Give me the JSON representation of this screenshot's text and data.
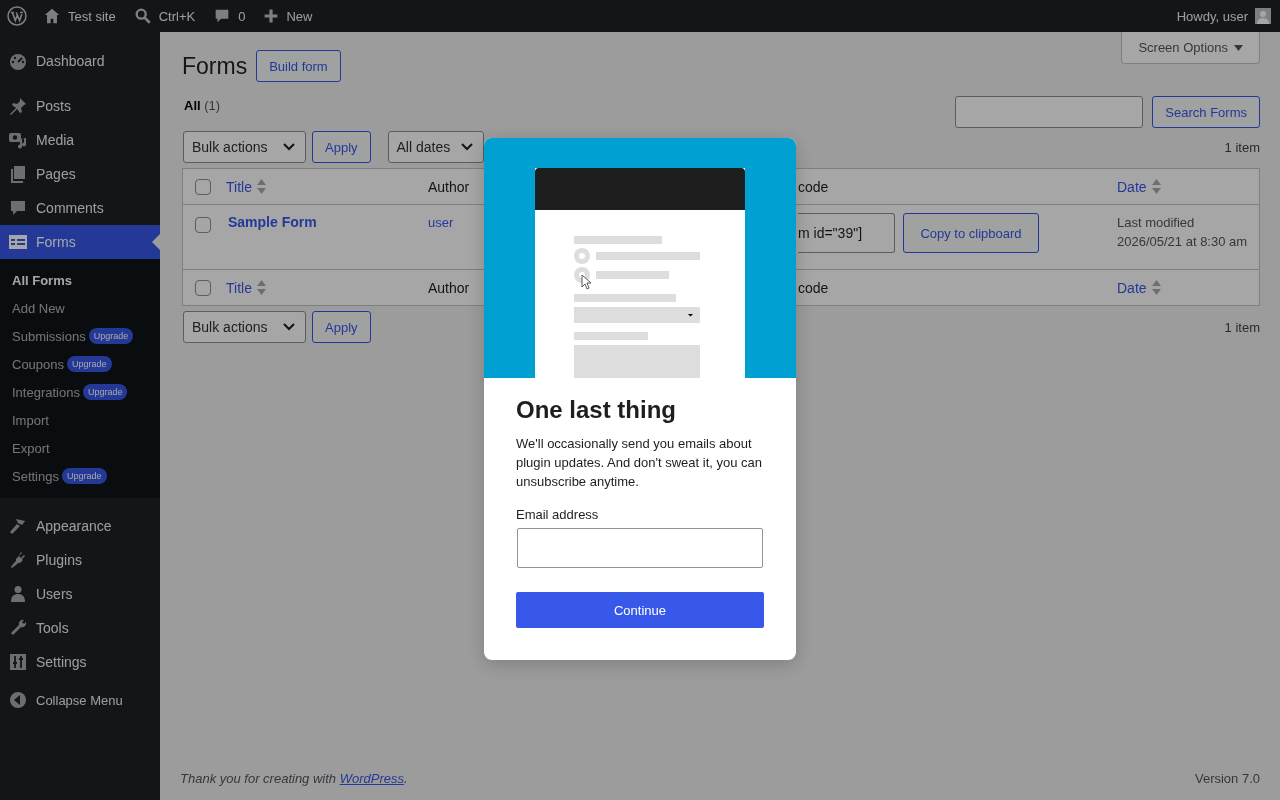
{
  "admin_bar": {
    "site": "Test site",
    "search": "Ctrl+K",
    "comments": "0",
    "new": "New",
    "greeting": "Howdy, user"
  },
  "sidebar": {
    "groups": [
      [
        {
          "label": "Dashboard",
          "selected": false
        }
      ],
      [
        {
          "label": "Posts",
          "selected": false
        },
        {
          "label": "Media",
          "selected": false
        },
        {
          "label": "Pages",
          "selected": false
        },
        {
          "label": "Comments",
          "selected": false
        },
        {
          "label": "Forms",
          "selected": true,
          "submenu": [
            {
              "label": "All Forms",
              "selected": true
            },
            {
              "label": "Add New",
              "selected": false
            },
            {
              "label": "Submissions",
              "badge": "Upgrade",
              "selected": false
            },
            {
              "label": "Coupons",
              "badge": "Upgrade",
              "selected": false
            },
            {
              "label": "Integrations",
              "badge": "Upgrade",
              "selected": false
            },
            {
              "label": "Import",
              "selected": false
            },
            {
              "label": "Export",
              "selected": false
            },
            {
              "label": "Settings",
              "badge": "Upgrade",
              "selected": false
            }
          ]
        }
      ],
      [
        {
          "label": "Appearance",
          "selected": false
        },
        {
          "label": "Plugins",
          "selected": false
        },
        {
          "label": "Users",
          "selected": false
        },
        {
          "label": "Tools",
          "selected": false
        },
        {
          "label": "Settings",
          "selected": false
        }
      ]
    ],
    "collapse": "Collapse Menu"
  },
  "page": {
    "title": "Forms",
    "build_button": "Build form",
    "screen_options": "Screen Options",
    "views": [
      {
        "label": "All",
        "count": "(1)",
        "selected": true
      }
    ],
    "search_button": "Search Forms",
    "top_nav": {
      "bulk": "Bulk actions",
      "apply": "Apply",
      "dates": "All dates",
      "count": "1 item"
    },
    "bottom_nav": {
      "bulk": "Bulk actions",
      "apply": "Apply",
      "count": "1 item"
    },
    "table": {
      "head_checked": false,
      "foot_checked": false,
      "columns": [
        {
          "label": "Title",
          "sortable": true
        },
        {
          "label": "Author",
          "sortable": false
        },
        {
          "label": "code",
          "sortable": false
        },
        {
          "label": "Date",
          "sortable": true
        }
      ],
      "footer_columns": [
        {
          "label": "Title",
          "sortable": true
        },
        {
          "label": "Author",
          "sortable": false
        },
        {
          "label": "code",
          "sortable": false
        },
        {
          "label": "Date",
          "sortable": true
        }
      ],
      "rows": [
        {
          "checked": false,
          "title": "Sample Form",
          "author": "user",
          "shortcode": "m id=\"39\"]",
          "copy": "Copy to clipboard",
          "date_status": "Last modified",
          "date": "2026/05/21 at 8:30 am"
        }
      ]
    }
  },
  "footer": {
    "thanks_before": "Thank you for creating with ",
    "thanks_link": "WordPress",
    "thanks_after": ".",
    "version": "Version 7.0"
  },
  "modal": {
    "title": "One last thing",
    "text": "We'll occasionally send you emails about plugin updates. And don't sweat it, you can unsubscribe anytime.",
    "email_label": "Email address",
    "button": "Continue"
  }
}
